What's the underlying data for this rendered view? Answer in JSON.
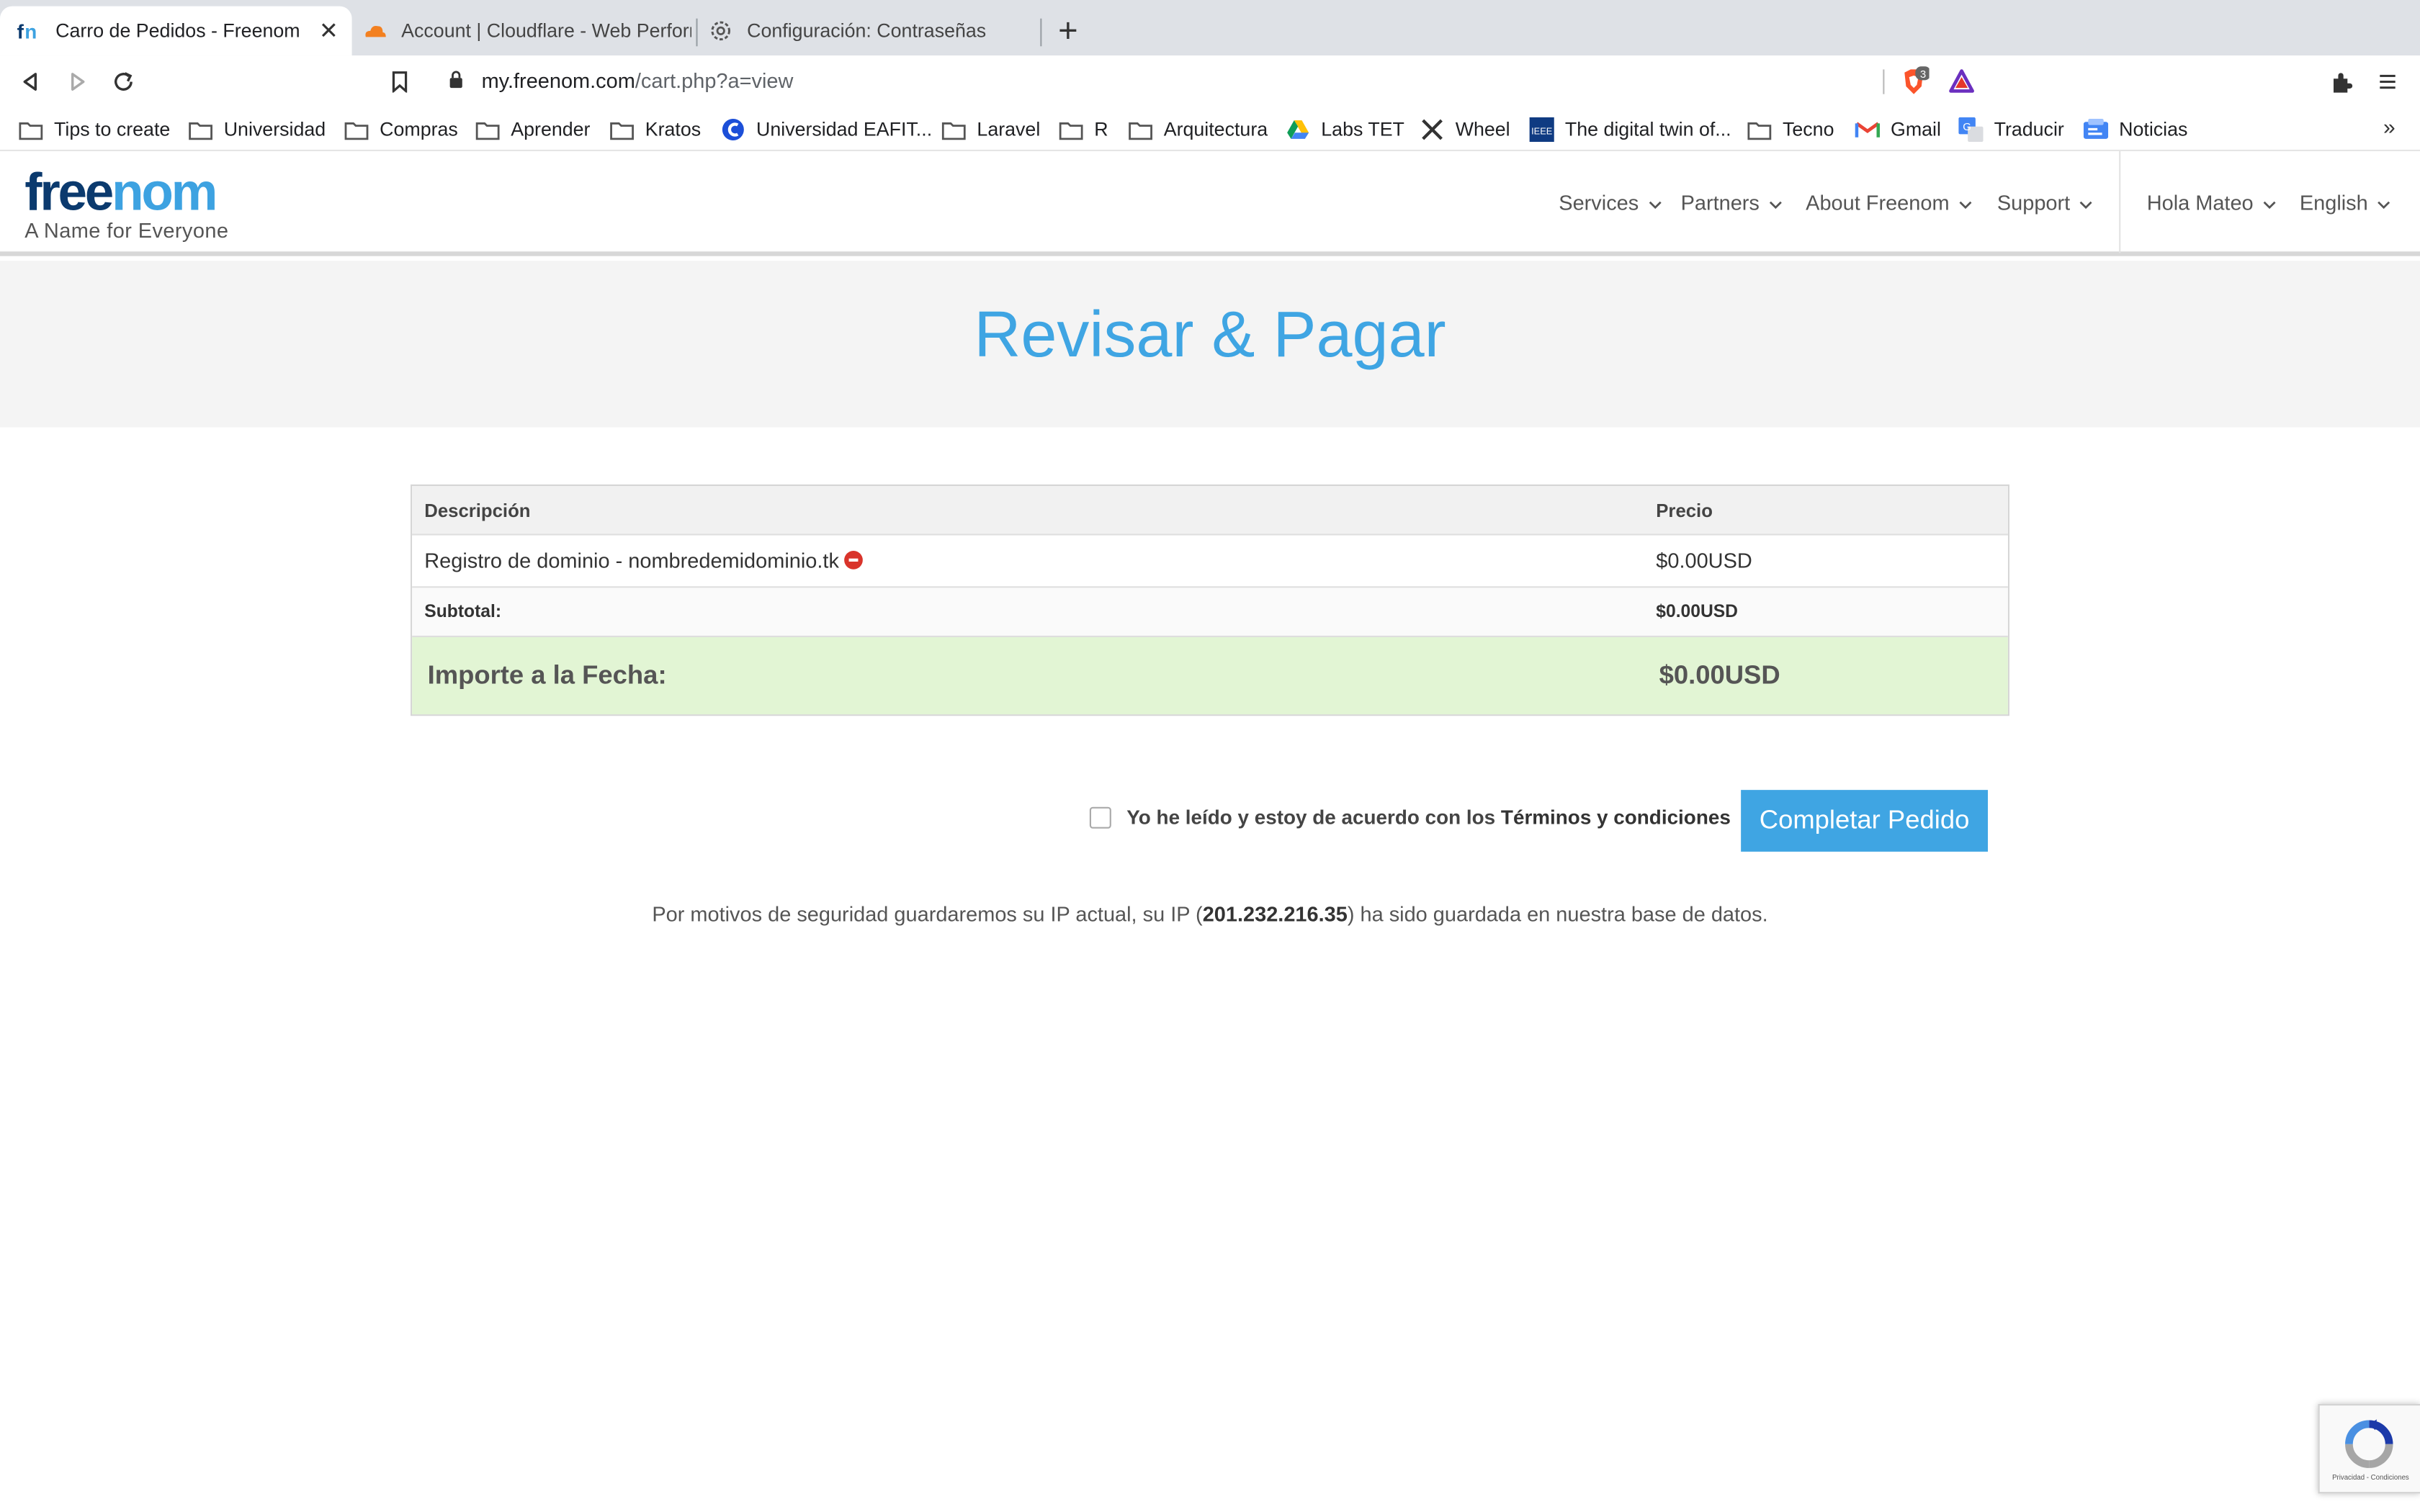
{
  "browser": {
    "tabs": [
      {
        "title": "Carro de Pedidos - Freenom",
        "icon": "freenom-favicon"
      },
      {
        "title": "Account | Cloudflare - Web Perform",
        "icon": "cloudflare-favicon"
      },
      {
        "title": "Configuración: Contraseñas",
        "icon": "settings-gear-icon"
      }
    ],
    "url_host": "my.freenom.com",
    "url_path": "/cart.php?a=view",
    "brave_badge": "3",
    "bookmarks": [
      {
        "label": "Tips to create",
        "icon": "folder-icon"
      },
      {
        "label": "Universidad",
        "icon": "folder-icon"
      },
      {
        "label": "Compras",
        "icon": "folder-icon"
      },
      {
        "label": "Aprender",
        "icon": "folder-icon"
      },
      {
        "label": "Kratos",
        "icon": "folder-icon"
      },
      {
        "label": "Universidad EAFIT...",
        "icon": "eafit-icon"
      },
      {
        "label": "Laravel",
        "icon": "folder-icon"
      },
      {
        "label": "R",
        "icon": "folder-icon"
      },
      {
        "label": "Arquitectura",
        "icon": "folder-icon"
      },
      {
        "label": "Labs TET",
        "icon": "google-drive-icon"
      },
      {
        "label": "Wheel",
        "icon": "tools-icon"
      },
      {
        "label": "The digital twin of...",
        "icon": "ieee-icon"
      },
      {
        "label": "Tecno",
        "icon": "folder-icon"
      },
      {
        "label": "Gmail",
        "icon": "gmail-icon"
      },
      {
        "label": "Traducir",
        "icon": "translate-icon"
      },
      {
        "label": "Noticias",
        "icon": "news-icon"
      }
    ],
    "bookmarks_more": "»"
  },
  "site": {
    "logo_part1": "free",
    "logo_part2": "nom",
    "tagline": "A Name for Everyone",
    "nav": [
      "Services",
      "Partners",
      "About Freenom",
      "Support"
    ],
    "user_menu": "Hola Mateo",
    "language": "English",
    "colors": {
      "brand_blue": "#3fa5e3",
      "brand_dark": "#0b3a6e",
      "total_bg": "#e2f5d4"
    }
  },
  "page": {
    "title": "Revisar & Pagar",
    "table": {
      "headers": [
        "Descripción",
        "Precio"
      ],
      "items": [
        {
          "description": "Registro de dominio - nombredemidominio.tk",
          "price": "$0.00USD"
        }
      ],
      "subtotal_label": "Subtotal:",
      "subtotal_value": "$0.00USD",
      "total_label": "Importe a la Fecha:",
      "total_value": "$0.00USD"
    },
    "agree_text": "Yo he leído y estoy de acuerdo con los ",
    "agree_link": "Términos y condiciones",
    "submit_label": "Completar Pedido",
    "notice_before": "Por motivos de seguridad guardaremos su IP actual, su IP (",
    "notice_ip": "201.232.216.35",
    "notice_after": ") ha sido guardada en nuestra base de datos.",
    "recaptcha_links": "Privacidad - Condiciones"
  }
}
